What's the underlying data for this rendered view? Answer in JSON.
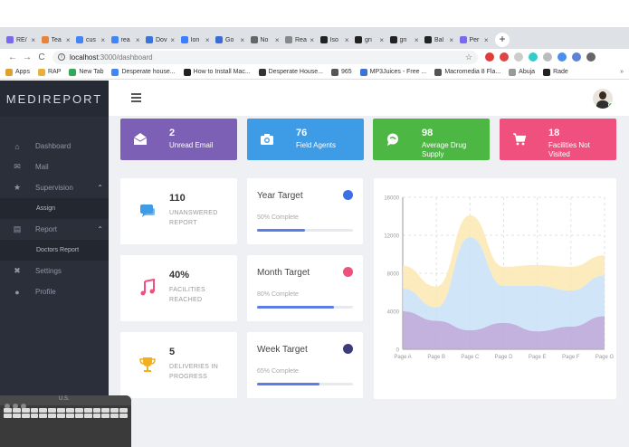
{
  "browser": {
    "tabs": [
      {
        "title": "RE/",
        "color": "#7b68ee"
      },
      {
        "title": "Tea",
        "color": "#e8833a"
      },
      {
        "title": "cus",
        "color": "#4285f4"
      },
      {
        "title": "rea",
        "color": "#4285f4"
      },
      {
        "title": "Dov",
        "color": "#3b73d8"
      },
      {
        "title": "Ion",
        "color": "#3880ff"
      },
      {
        "title": "Go",
        "color": "#3c6bd8"
      },
      {
        "title": "No",
        "color": "#666666"
      },
      {
        "title": "Rea",
        "color": "#888888"
      },
      {
        "title": "Iso",
        "color": "#222222"
      },
      {
        "title": "gri",
        "color": "#222222"
      },
      {
        "title": "gri",
        "color": "#222222"
      },
      {
        "title": "Bal",
        "color": "#222222"
      },
      {
        "title": "Per",
        "color": "#7b68ee"
      }
    ],
    "new_tab": "+",
    "back": "←",
    "forward": "→",
    "reload": "C",
    "url_host": "localhost",
    "url_path": ":3000/dashboard",
    "bookmarks": [
      {
        "label": "Apps",
        "color": "#e0a030"
      },
      {
        "label": "RAP",
        "color": "#e8b23a"
      },
      {
        "label": "New Tab",
        "color": "#34a853"
      },
      {
        "label": "Desperate house...",
        "color": "#4285f4"
      },
      {
        "label": "How to Install Mac...",
        "color": "#222222"
      },
      {
        "label": "Desperate House...",
        "color": "#333333"
      },
      {
        "label": "965",
        "color": "#555555"
      },
      {
        "label": "MP3Juices - Free ...",
        "color": "#3b73d8"
      },
      {
        "label": "Macromedia 8 Fla...",
        "color": "#555555"
      },
      {
        "label": "Abuja",
        "color": "#999999"
      },
      {
        "label": "Rade",
        "color": "#222222"
      }
    ],
    "bookmarks_more": "»"
  },
  "brand": "MEDIREPORT",
  "nav": {
    "items": [
      {
        "label": "Dashboard",
        "icon": "home-icon",
        "glyph": "⌂"
      },
      {
        "label": "Mail",
        "icon": "mail-icon",
        "glyph": "✉"
      },
      {
        "label": "Supervision",
        "icon": "star-icon",
        "glyph": "★",
        "chevron": "⌃"
      },
      {
        "label": "Assign",
        "sub": true
      },
      {
        "label": "Report",
        "icon": "clipboard-icon",
        "glyph": "▤",
        "chevron": "⌃"
      },
      {
        "label": "Doctors Report",
        "sub": true
      },
      {
        "label": "Settings",
        "icon": "tools-icon",
        "glyph": "✖"
      },
      {
        "label": "Profile",
        "icon": "user-icon",
        "glyph": "●"
      }
    ]
  },
  "stats": [
    {
      "value": "2",
      "label": "Unread Email",
      "color": "#7b60b6",
      "icon": "email-open-icon"
    },
    {
      "value": "76",
      "label": "Field Agents",
      "color": "#3e9be6",
      "icon": "camera-icon"
    },
    {
      "value": "98",
      "label": "Average Drug Supply",
      "color": "#4cb843",
      "icon": "chat-bubble-icon"
    },
    {
      "value": "18",
      "label": "Facilities Not Visited",
      "color": "#f0507d",
      "icon": "cart-icon"
    }
  ],
  "mini": [
    {
      "value": "110",
      "label": "UNANSWERED REPORT",
      "icon": "message-icon",
      "color": "#3e9be6"
    },
    {
      "value": "40%",
      "label": "FACILITIES REACHED",
      "icon": "music-icon",
      "color": "#f0507d"
    },
    {
      "value": "5",
      "label": "DELIVERIES IN PROGRESS",
      "icon": "trophy-icon",
      "color": "#f2b01e"
    }
  ],
  "targets": [
    {
      "title": "Year Target",
      "sub": "50% Complete",
      "progress": 0.5,
      "dot_color": "#3e6ee6"
    },
    {
      "title": "Month Target",
      "sub": "80% Complete",
      "progress": 0.8,
      "dot_color": "#f0507d"
    },
    {
      "title": "Week Target",
      "sub": "65% Complete",
      "progress": 0.65,
      "dot_color": "#3d3b7a"
    }
  ],
  "chart_data": {
    "type": "area",
    "categories": [
      "Page A",
      "Page B",
      "Page C",
      "Page D",
      "Page E",
      "Page F",
      "Page G"
    ],
    "ylim": [
      0,
      16000
    ],
    "yticks": [
      0,
      4000,
      8000,
      12000,
      16000
    ],
    "grid": true,
    "series": [
      {
        "values": [
          4000,
          3000,
          2000,
          2780,
          1890,
          2390,
          3490
        ],
        "color": "#b9a4d8"
      },
      {
        "values": [
          2400,
          1398,
          9800,
          3908,
          4800,
          3800,
          4300
        ],
        "color": "#c9e0f7"
      },
      {
        "values": [
          2400,
          2210,
          2290,
          2000,
          2181,
          2500,
          2100
        ],
        "color": "#fbe7b0"
      }
    ]
  },
  "mac_keyboard": {
    "title": "U.S."
  }
}
